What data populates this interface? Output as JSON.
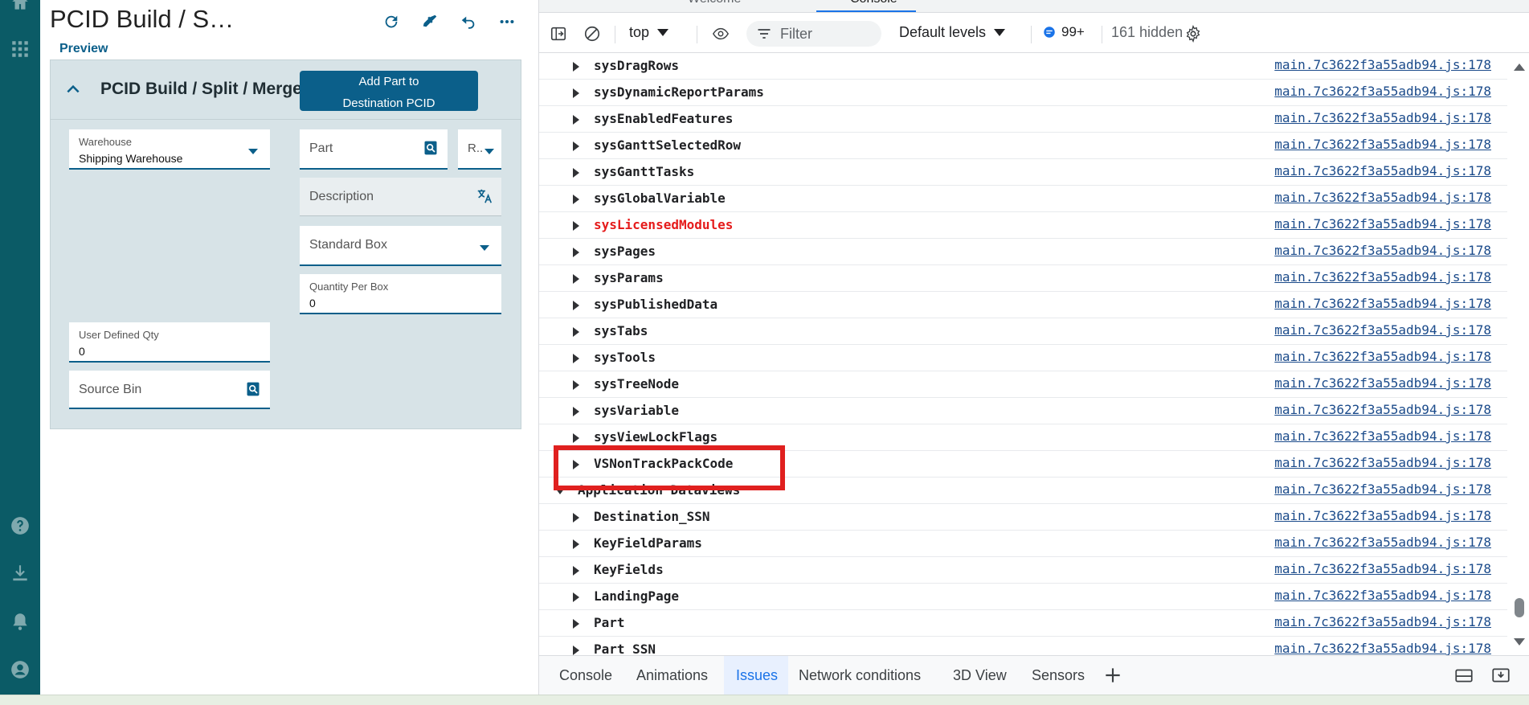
{
  "app": {
    "title": "PCID Build / S…",
    "preview_label": "Preview",
    "panel_title": "PCID Build / Split / Merge",
    "add_button": "Add Part to Destination PCID",
    "warehouse_label": "Warehouse",
    "warehouse_value": "Shipping Warehouse",
    "part_placeholder": "Part",
    "rev_placeholder": "R..",
    "description_placeholder": "Description",
    "box_value": "Standard Box",
    "qty_per_box_label": "Quantity Per Box",
    "qty_per_box_value": "0",
    "user_qty_label": "User Defined Qty",
    "user_qty_value": "0",
    "source_bin_placeholder": "Source Bin"
  },
  "devtools": {
    "tabs": [
      "Welcome",
      "Console"
    ],
    "toolbar": {
      "context": "top",
      "filter_placeholder": "Filter",
      "levels": "Default levels",
      "messages_count": "99+",
      "hidden": "161 hidden"
    },
    "source": "main.7c3622f3a55adb94.js:178",
    "rows": [
      {
        "name": "sysDragRows",
        "indent": 1,
        "expanded": false,
        "error": false
      },
      {
        "name": "sysDynamicReportParams",
        "indent": 1,
        "expanded": false,
        "error": false
      },
      {
        "name": "sysEnabledFeatures",
        "indent": 1,
        "expanded": false,
        "error": false
      },
      {
        "name": "sysGanttSelectedRow",
        "indent": 1,
        "expanded": false,
        "error": false
      },
      {
        "name": "sysGanttTasks",
        "indent": 1,
        "expanded": false,
        "error": false
      },
      {
        "name": "sysGlobalVariable",
        "indent": 1,
        "expanded": false,
        "error": false
      },
      {
        "name": "sysLicensedModules",
        "indent": 1,
        "expanded": false,
        "error": true
      },
      {
        "name": "sysPages",
        "indent": 1,
        "expanded": false,
        "error": false
      },
      {
        "name": "sysParams",
        "indent": 1,
        "expanded": false,
        "error": false
      },
      {
        "name": "sysPublishedData",
        "indent": 1,
        "expanded": false,
        "error": false
      },
      {
        "name": "sysTabs",
        "indent": 1,
        "expanded": false,
        "error": false
      },
      {
        "name": "sysTools",
        "indent": 1,
        "expanded": false,
        "error": false
      },
      {
        "name": "sysTreeNode",
        "indent": 1,
        "expanded": false,
        "error": false
      },
      {
        "name": "sysVariable",
        "indent": 1,
        "expanded": false,
        "error": false
      },
      {
        "name": "sysViewLockFlags",
        "indent": 1,
        "expanded": false,
        "error": false
      },
      {
        "name": "VSNonTrackPackCode",
        "indent": 1,
        "expanded": false,
        "error": false
      },
      {
        "name": "Application Dataviews",
        "indent": 0,
        "expanded": true,
        "error": false
      },
      {
        "name": "Destination_SSN",
        "indent": 1,
        "expanded": false,
        "error": false
      },
      {
        "name": "KeyFieldParams",
        "indent": 1,
        "expanded": false,
        "error": false
      },
      {
        "name": "KeyFields",
        "indent": 1,
        "expanded": false,
        "error": false
      },
      {
        "name": "LandingPage",
        "indent": 1,
        "expanded": false,
        "error": false
      },
      {
        "name": "Part",
        "indent": 1,
        "expanded": false,
        "error": false
      },
      {
        "name": "Part_SSN",
        "indent": 1,
        "expanded": false,
        "error": false
      }
    ],
    "drawer_tabs": [
      "Console",
      "Animations",
      "Issues",
      "Network conditions",
      "3D View",
      "Sensors"
    ],
    "active_drawer_tab": "Issues"
  }
}
